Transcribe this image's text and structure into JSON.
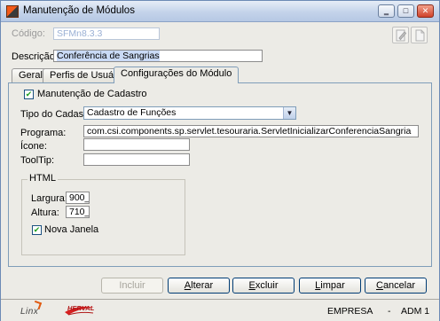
{
  "window": {
    "title": "Manutenção de Módulos",
    "controls": {
      "minimize": "‗",
      "maximize": "□",
      "close": "✕"
    }
  },
  "form": {
    "codigo": {
      "label": "Código:",
      "value": "SFMn8.3.3"
    },
    "descricao": {
      "label": "Descrição:",
      "value": "Conferência de Sangrias"
    }
  },
  "toolbar_icons": [
    "edit-doc-icon",
    "new-doc-icon"
  ],
  "tabs": [
    {
      "label": "Geral"
    },
    {
      "label": "Perfis de Usuários"
    },
    {
      "label": "Configurações do Módulo",
      "active": true
    }
  ],
  "config": {
    "manutencao": {
      "label": "Manutenção de Cadastro",
      "checked": true,
      "mark": "✔"
    },
    "tipo_cadastro": {
      "label": "Tipo do Cadastro:",
      "value": "Cadastro de Funções",
      "arrow": "▼"
    },
    "programa": {
      "label": "Programa:",
      "value": "com.csi.components.sp.servlet.tesouraria.ServletInicializarConferenciaSangria"
    },
    "icone": {
      "label": "Ícone:",
      "value": ""
    },
    "tooltip": {
      "label": "ToolTip:",
      "value": ""
    },
    "html": {
      "title": "HTML",
      "largura": {
        "label": "Largura:",
        "value": "900__"
      },
      "altura": {
        "label": "Altura:",
        "value": "710__"
      },
      "nova_janela": {
        "label": "Nova Janela",
        "checked": true,
        "mark": "✔"
      }
    }
  },
  "buttons": {
    "incluir": {
      "label": "Incluir",
      "enabled": false
    },
    "alterar": {
      "label": "Alterar",
      "key": "A",
      "rest": "lterar"
    },
    "excluir": {
      "label": "Excluir",
      "key": "E",
      "rest": "xcluir"
    },
    "limpar": {
      "label": "Limpar",
      "key": "L",
      "rest": "impar"
    },
    "cancelar": {
      "label": "Cancelar",
      "key": "C",
      "rest": "ancelar"
    }
  },
  "statusbar": {
    "logo_left": "Linx",
    "logo_right": "HERVAL",
    "empresa": "EMPRESA",
    "separator": "-",
    "user": "ADM 1"
  },
  "colors": {
    "titlebar": "#c4d3ea",
    "dialog_bg": "#ecebe6",
    "border_accent": "#7f9db9",
    "check_mark": "#21a121",
    "disabled_text": "#9a9a9a"
  }
}
